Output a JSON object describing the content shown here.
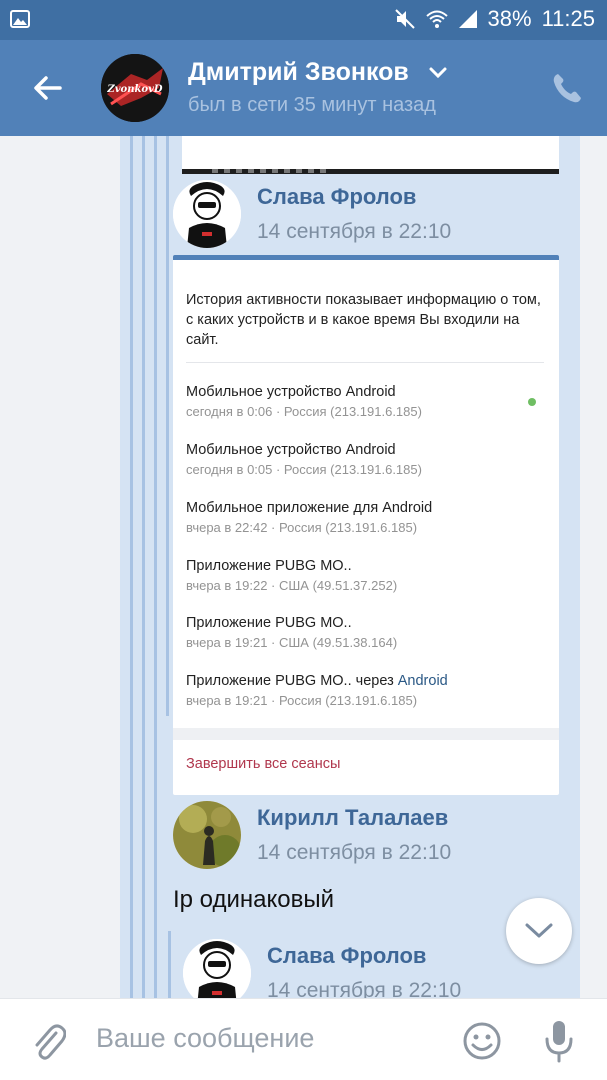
{
  "status_bar": {
    "battery": "38%",
    "time": "11:25",
    "icons": [
      "gallery-icon",
      "mute-icon",
      "wifi-icon",
      "signal-icon"
    ]
  },
  "header": {
    "contact_name": "Дмитрий Звонков",
    "last_seen": "был в сети 35 минут назад",
    "avatar_text": "ZvonkovD",
    "icons": [
      "back-arrow-icon",
      "chevron-down-icon",
      "phone-icon"
    ]
  },
  "messages": {
    "forward_1": {
      "author": "Слава Фролов",
      "date": "14 сентября в 22:10"
    },
    "activity_card": {
      "intro": "История активности показывает информацию о том, с каких устройств и в какое время Вы входили на сайт.",
      "sessions": [
        {
          "title": "Мобильное устройство Android",
          "title_link": "",
          "sub": "сегодня в 0:06 · Россия (213.191.6.185)",
          "online": true
        },
        {
          "title": "Мобильное устройство Android",
          "title_link": "",
          "sub": "сегодня в 0:05 · Россия (213.191.6.185)",
          "online": false
        },
        {
          "title": "Мобильное приложение для Android",
          "title_link": "",
          "sub": "вчера в 22:42 · Россия (213.191.6.185)",
          "online": false
        },
        {
          "title": "Приложение PUBG MO..",
          "title_link": "",
          "sub": "вчера в 19:22 · США (49.51.37.252)",
          "online": false
        },
        {
          "title": "Приложение PUBG MO..",
          "title_link": "",
          "sub": "вчера в 19:21 · США (49.51.38.164)",
          "online": false
        },
        {
          "title": "Приложение PUBG MO.. через ",
          "title_link": "Android",
          "sub": "вчера в 19:21 · Россия (213.191.6.185)",
          "online": false
        }
      ],
      "end_all_sessions": "Завершить все сеансы"
    },
    "forward_2": {
      "author": "Кирилл Талалаев",
      "date": "14 сентября в 22:10",
      "text": "Ip одинаковый"
    },
    "forward_3": {
      "author": "Слава Фролов",
      "date": "14 сентября в 22:10"
    }
  },
  "composer": {
    "placeholder": "Ваше сообщение",
    "icons": [
      "attach-icon",
      "emoji-icon",
      "microphone-icon"
    ]
  },
  "colors": {
    "header_bg": "#5181b8",
    "status_bg": "#3f6fa3",
    "bubble_bg": "#d5e3f3",
    "author_name": "#3e6797",
    "end_sessions": "#b0374d",
    "online_dot": "#6fbe63"
  }
}
